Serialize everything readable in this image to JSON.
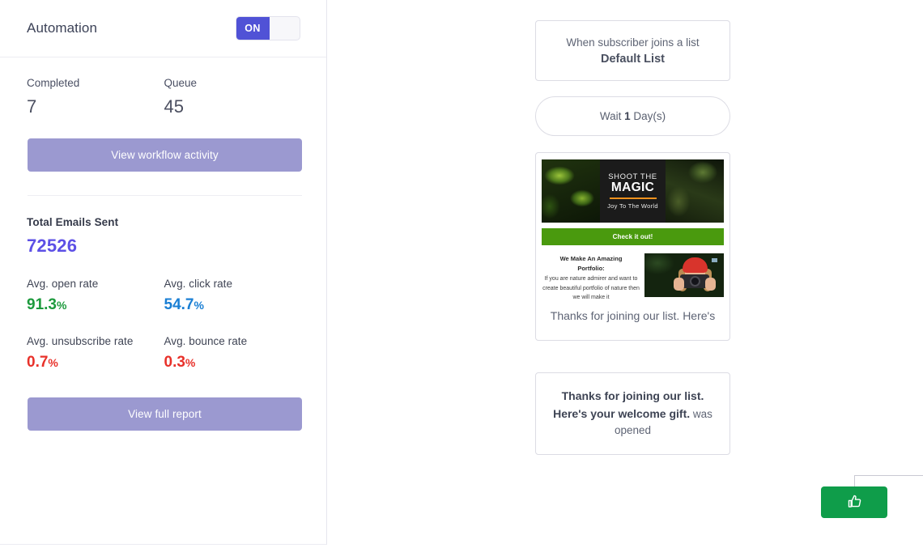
{
  "sidebar": {
    "title": "Automation",
    "toggle": {
      "state_label": "ON",
      "accent": "#5052d6"
    },
    "kpis": [
      {
        "label": "Completed",
        "value": "7"
      },
      {
        "label": "Queue",
        "value": "45"
      }
    ],
    "workflow_button": "View workflow activity",
    "report_button": "View full report",
    "total_emails": {
      "label": "Total Emails Sent",
      "value": "72526",
      "color": "#5d50e6"
    },
    "rates": [
      {
        "label": "Avg. open rate",
        "value": "91.3",
        "unit": "%",
        "color": "#1d9a3d"
      },
      {
        "label": "Avg. click rate",
        "value": "54.7",
        "unit": "%",
        "color": "#1a7fd4"
      },
      {
        "label": "Avg. unsubscribe rate",
        "value": "0.7",
        "unit": "%",
        "color": "#e8312a"
      },
      {
        "label": "Avg. bounce rate",
        "value": "0.3",
        "unit": "%",
        "color": "#e8312a"
      }
    ]
  },
  "flow": {
    "trigger": {
      "line1": "When subscriber joins a list",
      "line2": "Default List"
    },
    "wait": {
      "prefix": "Wait",
      "amount": "1",
      "suffix": "Day(s)"
    },
    "email": {
      "banner": {
        "line1": "SHOOT THE",
        "line2": "MAGIC",
        "tagline": "Joy To The World",
        "rule_color": "#f0921e"
      },
      "cta_label": "Check it out!",
      "cta_color": "#4a9a0e",
      "promo_heading_line1": "We Make An Amazing",
      "promo_heading_line2": "Portfolio:",
      "promo_body": "If you are nature admirer and want to create beautiful portfolio of nature then we will make it",
      "caption": "Thanks for joining our list. Here's"
    },
    "condition": {
      "icon": "swap-icon",
      "subject": "Thanks for joining our list. Here's your welcome gift.",
      "suffix": "was opened"
    },
    "branches": [
      {
        "name": "yes-branch",
        "icon": "thumbs-up-icon",
        "color": "#0f9d4a"
      },
      {
        "name": "no-branch",
        "icon": "thumbs-down-icon",
        "color": "#e8392b"
      }
    ]
  }
}
